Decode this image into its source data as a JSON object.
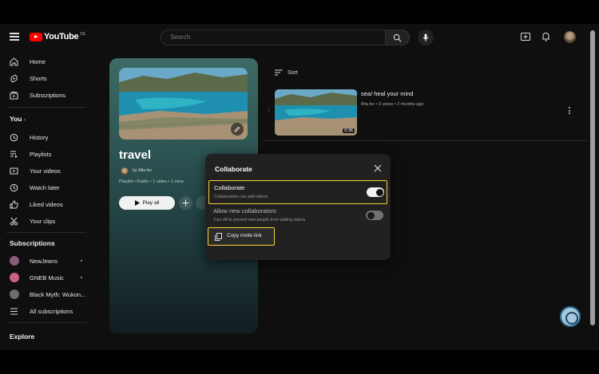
{
  "header": {
    "logo_text": "YouTube",
    "logo_sup": "DE",
    "search_placeholder": "Search"
  },
  "sidebar": {
    "main": [
      {
        "label": "Home",
        "icon": "home-icon"
      },
      {
        "label": "Shorts",
        "icon": "shorts-icon"
      },
      {
        "label": "Subscriptions",
        "icon": "subscriptions-icon"
      }
    ],
    "you_title": "You",
    "you_items": [
      {
        "label": "History",
        "icon": "history-icon"
      },
      {
        "label": "Playlists",
        "icon": "playlists-icon"
      },
      {
        "label": "Your videos",
        "icon": "your-videos-icon"
      },
      {
        "label": "Watch later",
        "icon": "watch-later-icon"
      },
      {
        "label": "Liked videos",
        "icon": "liked-videos-icon"
      },
      {
        "label": "Your clips",
        "icon": "clips-icon"
      }
    ],
    "subs_title": "Subscriptions",
    "subs": [
      {
        "label": "NewJeans",
        "color": "#8c5a7a"
      },
      {
        "label": "GNEB Music",
        "color": "#c9628a"
      },
      {
        "label": "Black Myth: Wukon...",
        "color": "#6d6d6d"
      }
    ],
    "all_subs_label": "All subscriptions",
    "explore_title": "Explore"
  },
  "playlist": {
    "title": "travel",
    "owner": "by Mia fer",
    "meta": "Playlist • Public • 1 video • 1 view",
    "play_all_label": "Play all"
  },
  "list": {
    "sort_label": "Sort",
    "videos": [
      {
        "title": "sea/ heal your mind",
        "meta": "Mia fer • 3 views • 2 months ago",
        "duration": "0:36"
      }
    ]
  },
  "dialog": {
    "title": "Collaborate",
    "collab_title": "Collaborate",
    "collab_desc": "Collaborators can add videos",
    "collab_on": true,
    "allow_title": "Allow new collaborators",
    "allow_desc": "Turn off to prevent new people from adding videos",
    "allow_on": false,
    "copy_link_label": "Copy invite link"
  },
  "colors": {
    "highlight": "#f7d13a",
    "brand_red": "#ff0000"
  }
}
